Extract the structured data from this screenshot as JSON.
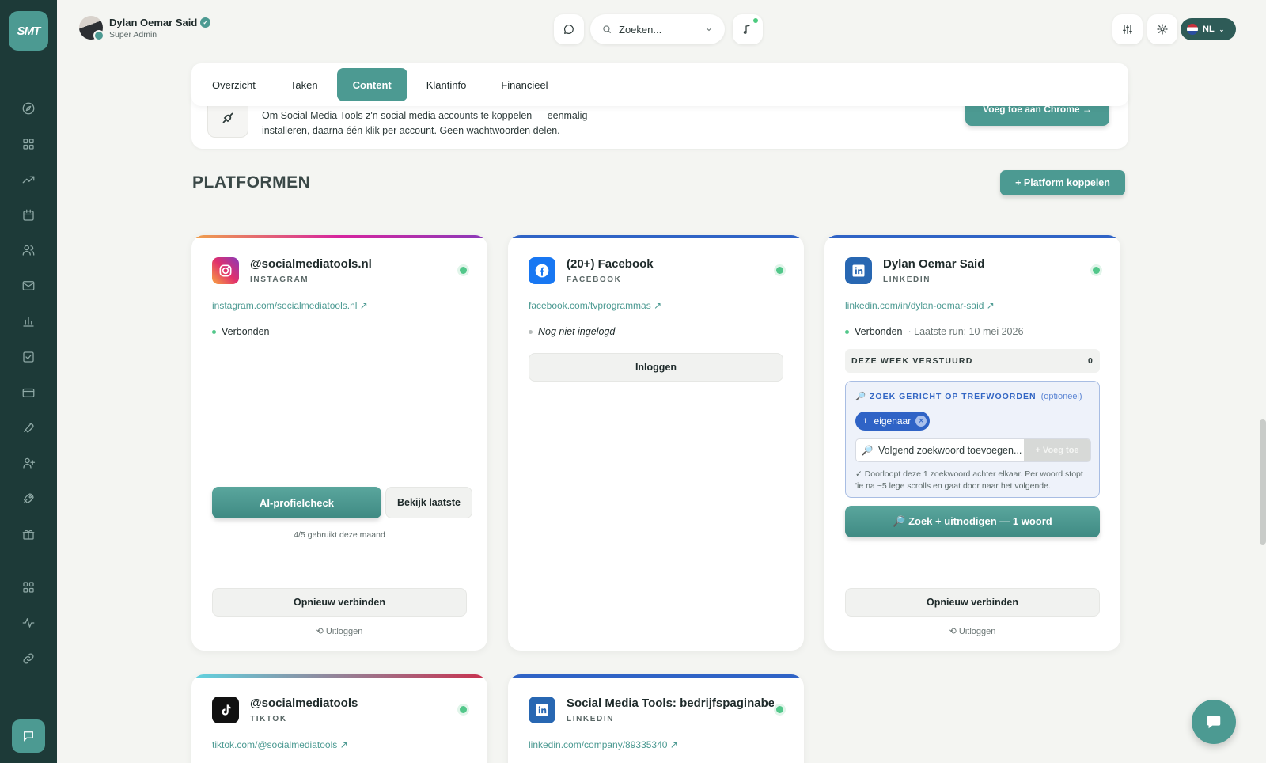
{
  "app": {
    "logo": "SMT"
  },
  "user": {
    "name": "Dylan Oemar Said",
    "role": "Super Admin"
  },
  "header": {
    "search_placeholder": "Zoeken...",
    "lang": "NL"
  },
  "tabs": [
    {
      "label": "Overzicht",
      "active": false
    },
    {
      "label": "Taken",
      "active": false
    },
    {
      "label": "Content",
      "active": true
    },
    {
      "label": "Klantinfo",
      "active": false
    },
    {
      "label": "Financieel",
      "active": false
    }
  ],
  "banner": {
    "text": "Om Social Media Tools z'n social media accounts te koppelen — eenmalig installeren, daarna één klik per account. Geen wachtwoorden delen.",
    "button": "Voeg toe aan Chrome →"
  },
  "section": {
    "title": "PLATFORMEN",
    "add_button": "+ Platform koppelen"
  },
  "cards": {
    "instagram": {
      "name": "@socialmediatools.nl",
      "type": "INSTAGRAM",
      "link": "instagram.com/socialmediatools.nl ↗",
      "status": "Verbonden",
      "ai_button": "AI-profielcheck",
      "last_button": "Bekijk laatste",
      "usage": "4/5 gebruikt deze maand",
      "reconnect": "Opnieuw verbinden",
      "logout": "⟲ Uitloggen"
    },
    "facebook": {
      "name": "(20+) Facebook",
      "type": "FACEBOOK",
      "link": "facebook.com/tvprogrammas ↗",
      "status": "Nog niet ingelogd",
      "login": "Inloggen"
    },
    "linkedin": {
      "name": "Dylan Oemar Said",
      "type": "LINKEDIN",
      "link": "linkedin.com/in/dylan-oemar-said ↗",
      "status": "Verbonden",
      "status_meta": "· Laatste run: 10 mei 2026",
      "week_label": "DEZE WEEK VERSTUURD",
      "week_count": "0",
      "kw_title": "🔎 ZOEK GERICHT OP TREFWOORDEN",
      "kw_optional": "(optioneel)",
      "chip_num": "1.",
      "chip_label": "eigenaar",
      "chip_remove": "✕",
      "kw_placeholder": "Volgend zoekwoord toevoegen...",
      "kw_add": "+ Voeg toe",
      "kw_help": "✓ Doorloopt deze 1 zoekwoord achter elkaar. Per woord stopt 'ie na ~5 lege scrolls en gaat door naar het volgende.",
      "search_button": "🔎 Zoek + uitnodigen — 1 woord",
      "reconnect": "Opnieuw verbinden",
      "logout": "⟲ Uitloggen"
    },
    "tiktok": {
      "name": "@socialmediatools",
      "type": "TIKTOK",
      "link": "tiktok.com/@socialmediatools ↗"
    },
    "linkedin_company": {
      "name": "Social Media Tools: bedrijfspaginabe",
      "type": "LINKEDIN",
      "link": "linkedin.com/company/89335340 ↗"
    }
  },
  "colors": {
    "accent": "#4c9a92",
    "sidebar": "#1d3a38",
    "instagram": "#d6249f",
    "facebook": "#1877f2",
    "linkedin": "#2867b2",
    "tiktok": "#111111"
  }
}
